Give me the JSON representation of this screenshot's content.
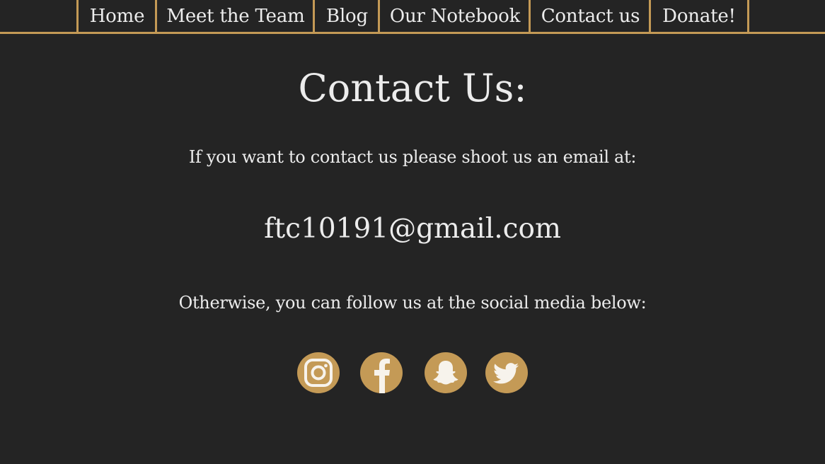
{
  "nav": {
    "items": [
      {
        "label": "Home"
      },
      {
        "label": "Meet the Team"
      },
      {
        "label": "Blog"
      },
      {
        "label": "Our Notebook"
      },
      {
        "label": "Contact us"
      },
      {
        "label": "Donate!"
      }
    ]
  },
  "main": {
    "title": "Contact Us:",
    "intro": "If you want to contact us please shoot us an email at:",
    "email": "ftc10191@gmail.com",
    "social_text": "Otherwise, you can follow us at the social media below:"
  },
  "social": {
    "icons": [
      "instagram-icon",
      "facebook-icon",
      "snapchat-icon",
      "twitter-icon"
    ]
  },
  "colors": {
    "background": "#242424",
    "accent": "#c49a56",
    "text": "#ececec"
  }
}
